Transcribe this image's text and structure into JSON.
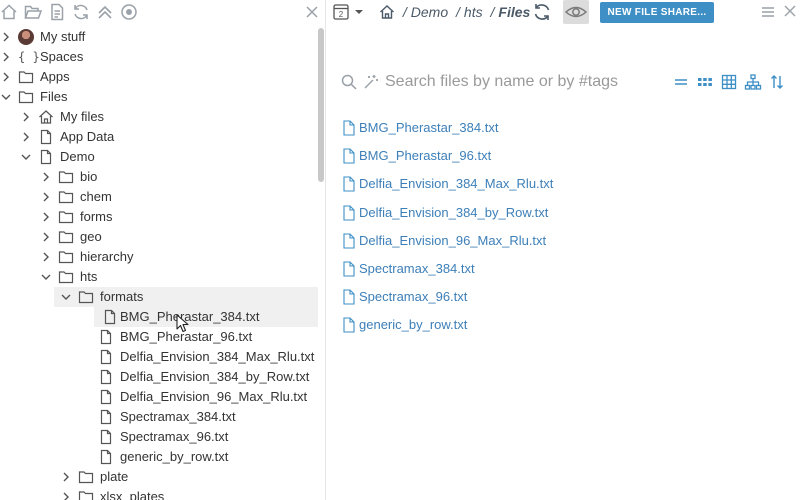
{
  "left_toolbar": {
    "icons": [
      "home-icon",
      "open-folder-icon",
      "document-icon",
      "refresh-icon",
      "collapse-all-icon",
      "circle-dot-icon",
      "close-icon"
    ]
  },
  "tree": [
    {
      "label": "My stuff",
      "icon": "avatar",
      "depth": 0,
      "expanded": false
    },
    {
      "label": "Spaces",
      "icon": "braces-icon",
      "depth": 0,
      "expanded": false
    },
    {
      "label": "Apps",
      "icon": "folder-icon",
      "depth": 0,
      "expanded": false
    },
    {
      "label": "Files",
      "icon": "folder-icon",
      "depth": 0,
      "expanded": true
    },
    {
      "label": "My files",
      "icon": "home-icon",
      "depth": 1,
      "expanded": false
    },
    {
      "label": "App Data",
      "icon": "document-icon",
      "depth": 1,
      "expanded": false
    },
    {
      "label": "Demo",
      "icon": "document-icon",
      "depth": 1,
      "expanded": true
    },
    {
      "label": "bio",
      "icon": "folder-icon",
      "depth": 2,
      "expanded": false
    },
    {
      "label": "chem",
      "icon": "folder-icon",
      "depth": 2,
      "expanded": false
    },
    {
      "label": "forms",
      "icon": "folder-icon",
      "depth": 2,
      "expanded": false
    },
    {
      "label": "geo",
      "icon": "folder-icon",
      "depth": 2,
      "expanded": false
    },
    {
      "label": "hierarchy",
      "icon": "folder-icon",
      "depth": 2,
      "expanded": false
    },
    {
      "label": "hts",
      "icon": "folder-icon",
      "depth": 2,
      "expanded": true
    },
    {
      "label": "formats",
      "icon": "folder-icon",
      "depth": 3,
      "expanded": true,
      "selected": true
    },
    {
      "label": "BMG_Pherastar_384.txt",
      "icon": "file-icon",
      "depth": 4,
      "leaf": true,
      "hover": true
    },
    {
      "label": "BMG_Pherastar_96.txt",
      "icon": "file-icon",
      "depth": 4,
      "leaf": true
    },
    {
      "label": "Delfia_Envision_384_Max_Rlu.txt",
      "icon": "file-icon",
      "depth": 4,
      "leaf": true
    },
    {
      "label": "Delfia_Envision_384_by_Row.txt",
      "icon": "file-icon",
      "depth": 4,
      "leaf": true
    },
    {
      "label": "Delfia_Envision_96_Max_Rlu.txt",
      "icon": "file-icon",
      "depth": 4,
      "leaf": true
    },
    {
      "label": "Spectramax_384.txt",
      "icon": "file-icon",
      "depth": 4,
      "leaf": true
    },
    {
      "label": "Spectramax_96.txt",
      "icon": "file-icon",
      "depth": 4,
      "leaf": true
    },
    {
      "label": "generic_by_row.txt",
      "icon": "file-icon",
      "depth": 4,
      "leaf": true
    },
    {
      "label": "plate",
      "icon": "folder-icon",
      "depth": 3,
      "expanded": false
    },
    {
      "label": "xlsx_plates",
      "icon": "folder-icon",
      "depth": 3,
      "expanded": false
    }
  ],
  "right_toolbar": {
    "view_toggle_number": "2",
    "breadcrumb": {
      "root_icon": "home-icon",
      "parts": [
        "Demo",
        "hts",
        "Files"
      ]
    },
    "share_button_label": "NEW FILE SHARE..."
  },
  "search": {
    "placeholder": "Search files by name or by #tags",
    "value": "",
    "view_icons": [
      "list-view-icon",
      "grid-view-icon",
      "table-view-icon",
      "tree-view-icon",
      "sort-icon"
    ]
  },
  "files": [
    "BMG_Pherastar_384.txt",
    "BMG_Pherastar_96.txt",
    "Delfia_Envision_384_Max_Rlu.txt",
    "Delfia_Envision_384_by_Row.txt",
    "Delfia_Envision_96_Max_Rlu.txt",
    "Spectramax_384.txt",
    "Spectramax_96.txt",
    "generic_by_row.txt"
  ],
  "colors": {
    "accent": "#3d8fc6",
    "link": "#3d7fb8",
    "selected_row": "#f0f0f0",
    "icon_gray": "#9aa1a8"
  }
}
